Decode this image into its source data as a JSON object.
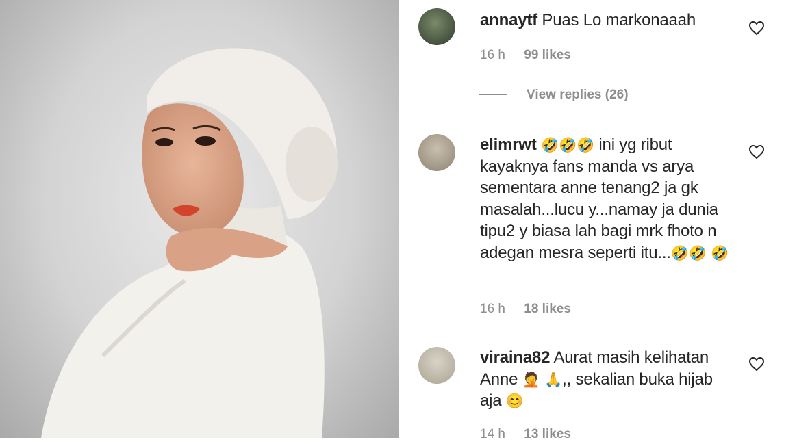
{
  "comments": [
    {
      "username": "annaytf",
      "text": "Puas Lo markonaaah",
      "time": "16 h",
      "likes": "99 likes",
      "view_replies": "View replies (26)"
    },
    {
      "username": "elimrwt",
      "text_a": " ini yg ribut kayaknya fans manda vs arya sementara anne tenang2 ja gk masalah...lucu y...namay ja dunia tipu2 y biasa lah bagi mrk fhoto n adegan mesra seperti itu...",
      "time": "16 h",
      "likes": "18 likes"
    },
    {
      "username": "viraina82",
      "text_a": "Aurat masih kelihatan Anne ",
      "text_b": ",, sekalian buka hijab aja ",
      "time": "14 h",
      "likes": "13 likes"
    }
  ],
  "icons": {
    "laugh": "🤣",
    "facepalm": "🤦",
    "pray": "🙏",
    "smile": "😊"
  }
}
